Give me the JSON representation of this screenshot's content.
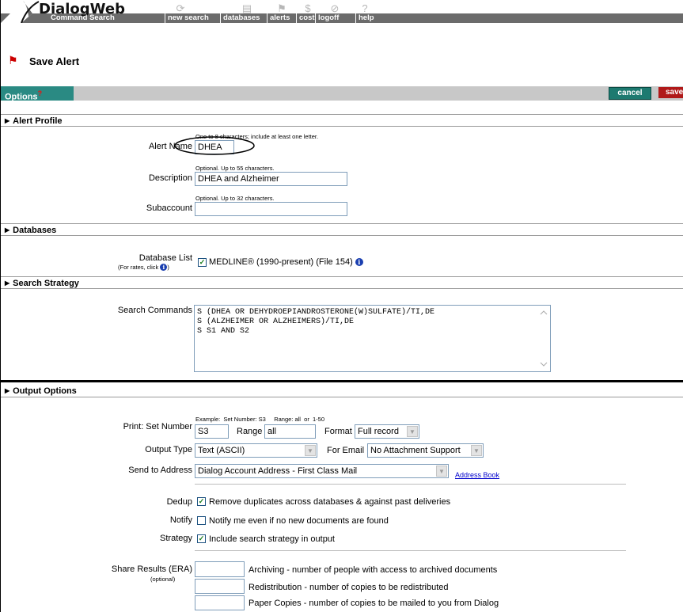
{
  "app": {
    "logo": "DialogWeb",
    "mode_label": "Command Search",
    "nav": [
      "new search",
      "databases",
      "alerts",
      "cost",
      "logoff",
      "help"
    ],
    "toolbar_icons": [
      "refresh-icon",
      "documents-icon",
      "alert-flag-icon",
      "cost-dollar-icon",
      "logoff-icon",
      "help-icon"
    ]
  },
  "page": {
    "title": "Save Alert",
    "title_icon": "alert-flag-icon"
  },
  "options_bar": {
    "tab_label": "Options",
    "help_mark": "?",
    "cancel_label": "cancel",
    "save_label": "save"
  },
  "alert_profile": {
    "header": "Alert Profile",
    "name_hint": "One to 8 characters; include at least one letter.",
    "name_label": "Alert Name",
    "name_value": "DHEA",
    "desc_hint": "Optional. Up to 55 characters.",
    "desc_label": "Description",
    "desc_value": "DHEA and Alzheimer",
    "sub_hint": "Optional. Up to 32 characters.",
    "sub_label": "Subaccount",
    "sub_value": ""
  },
  "databases": {
    "header": "Databases",
    "list_label": "Database List",
    "list_sublabel": "(For rates, click",
    "list_sublabel_end": ")",
    "item": "MEDLINE® (1990-present) (File 154)",
    "item_checked": true
  },
  "search_strategy": {
    "header": "Search Strategy",
    "label": "Search Commands",
    "commands": [
      "S (DHEA OR DEHYDROEPIANDROSTERONE(W)SULFATE)/TI,DE",
      "S (ALZHEIMER OR ALZHEIMERS)/TI,DE",
      "S S1 AND S2"
    ]
  },
  "output_options": {
    "header": "Output Options",
    "example_hint": "Example:  Set Number: S3     Range: all  or  1-50",
    "print_label": "Print: Set Number",
    "set_number": "S3",
    "range_label": "Range",
    "range_value": "all",
    "format_label": "Format",
    "format_value": "Full record",
    "output_type_label": "Output Type",
    "output_type_value": "Text (ASCII)",
    "for_email_label": "For Email",
    "for_email_value": "No Attachment Support",
    "send_to_label": "Send to Address",
    "send_to_value": "Dialog Account Address - First Class Mail",
    "address_book": "Address Book",
    "dedup_label": "Dedup",
    "dedup_text": "Remove duplicates across databases & against past deliveries",
    "dedup_checked": true,
    "notify_label": "Notify",
    "notify_text": "Notify me even if no new documents are found",
    "notify_checked": false,
    "strategy_label": "Strategy",
    "strategy_text": "Include search strategy in output",
    "strategy_checked": true,
    "share_label": "Share Results (ERA)",
    "share_optional": "(optional)",
    "archiving_text": "Archiving - number of people with access to archived documents",
    "redistribution_text": "Redistribution - number of copies to be redistributed",
    "paper_text": "Paper Copies - number of copies to be mailed to you from Dialog"
  },
  "colors": {
    "header_gray": "#6b6b6b",
    "options_teal": "#2a8a83",
    "save_red": "#b01919",
    "checkbox_green": "#157a1a"
  }
}
